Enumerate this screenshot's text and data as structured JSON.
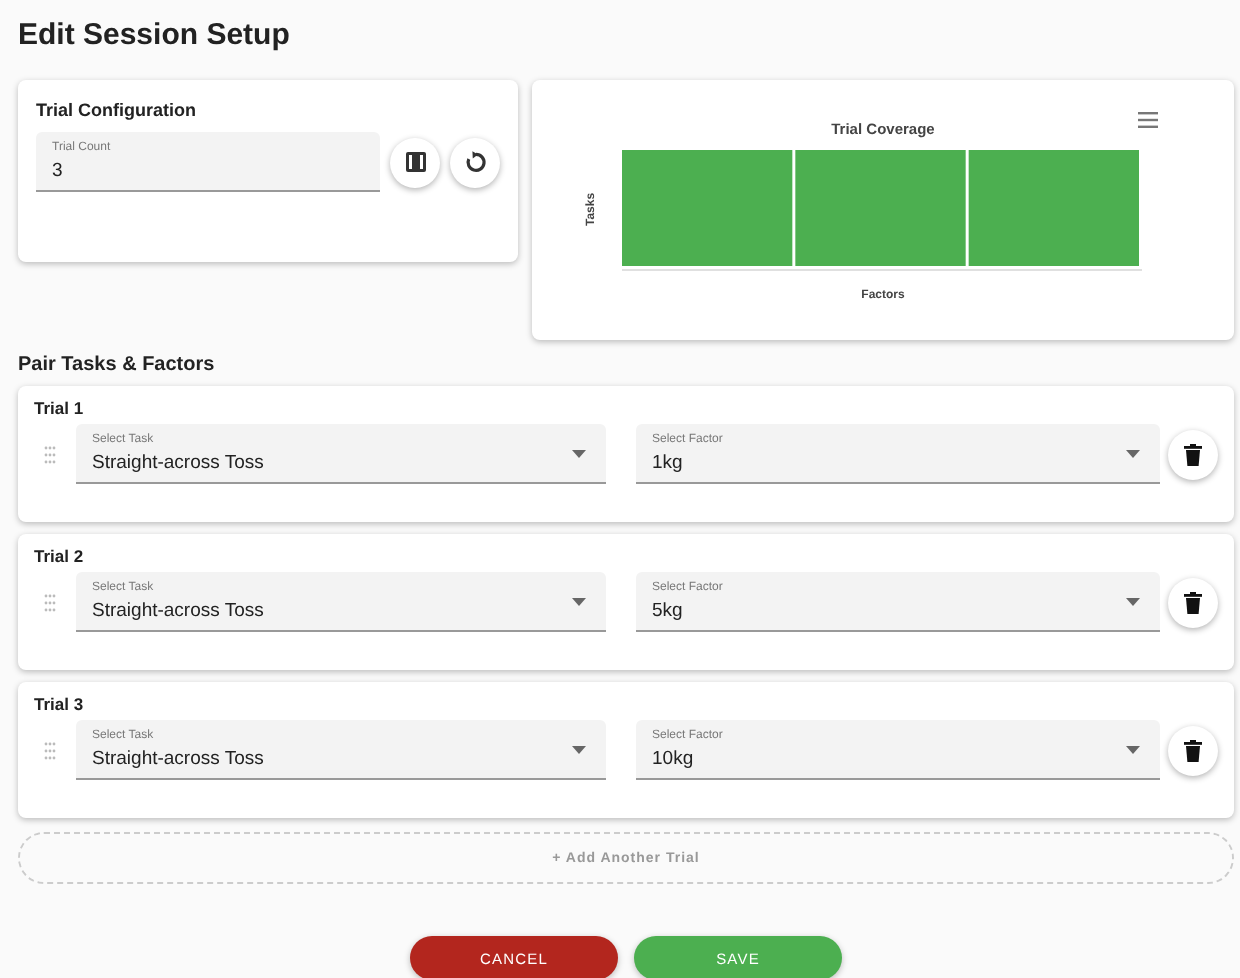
{
  "title": "Edit Session Setup",
  "config": {
    "title": "Trial Configuration",
    "trial_count": {
      "label": "Trial Count",
      "value": "3"
    }
  },
  "coverage": {
    "title": "Trial Coverage",
    "ylabel": "Tasks",
    "xlabel": "Factors"
  },
  "section_title": "Pair Tasks & Factors",
  "trials": [
    {
      "title": "Trial 1",
      "task": {
        "label": "Select Task",
        "value": "Straight-across Toss"
      },
      "factor": {
        "label": "Select Factor",
        "value": "1kg"
      }
    },
    {
      "title": "Trial 2",
      "task": {
        "label": "Select Task",
        "value": "Straight-across Toss"
      },
      "factor": {
        "label": "Select Factor",
        "value": "5kg"
      }
    },
    {
      "title": "Trial 3",
      "task": {
        "label": "Select Task",
        "value": "Straight-across Toss"
      },
      "factor": {
        "label": "Select Factor",
        "value": "10kg"
      }
    }
  ],
  "add_button": "+ Add Another Trial",
  "buttons": [
    {
      "kind": "cancel",
      "label": "CANCEL"
    },
    {
      "kind": "save",
      "label": "SAVE"
    }
  ]
}
